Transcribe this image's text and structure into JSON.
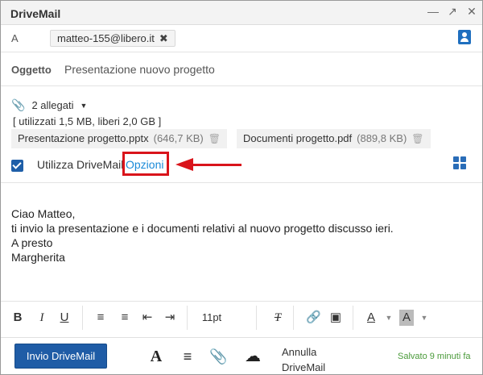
{
  "window": {
    "title": "DriveMail"
  },
  "recipients": {
    "label": "A",
    "chips": [
      "matteo-155@libero.it"
    ]
  },
  "subject": {
    "label": "Oggetto",
    "value": "Presentazione nuovo progetto"
  },
  "attachments": {
    "summary": "2 allegati",
    "quota": "[ utilizzati 1,5 MB, liberi 2,0 GB ]",
    "files": [
      {
        "name": "Presentazione progetto.pptx",
        "size": "(646,7 KB)"
      },
      {
        "name": "Documenti progetto.pdf",
        "size": "(889,8 KB)"
      }
    ]
  },
  "drivemail": {
    "use_label": "Utilizza DriveMail",
    "options_label": "Opzioni",
    "enabled": true
  },
  "message": {
    "lines": [
      "Ciao Matteo,",
      "ti invio la presentazione e i documenti relativi al nuovo progetto discusso ieri.",
      "A presto",
      "Margherita"
    ]
  },
  "format_toolbar": {
    "font_size": "11pt"
  },
  "footer": {
    "send_label": "Invio DriveMail",
    "cancel_line1": "Annulla",
    "cancel_line2": "DriveMail",
    "saved_status": "Salvato 9 minuti fa"
  },
  "colors": {
    "accent": "#1f5ca6",
    "highlight": "#d9141b",
    "link": "#1a8ad8",
    "saved": "#4a9a3a"
  }
}
